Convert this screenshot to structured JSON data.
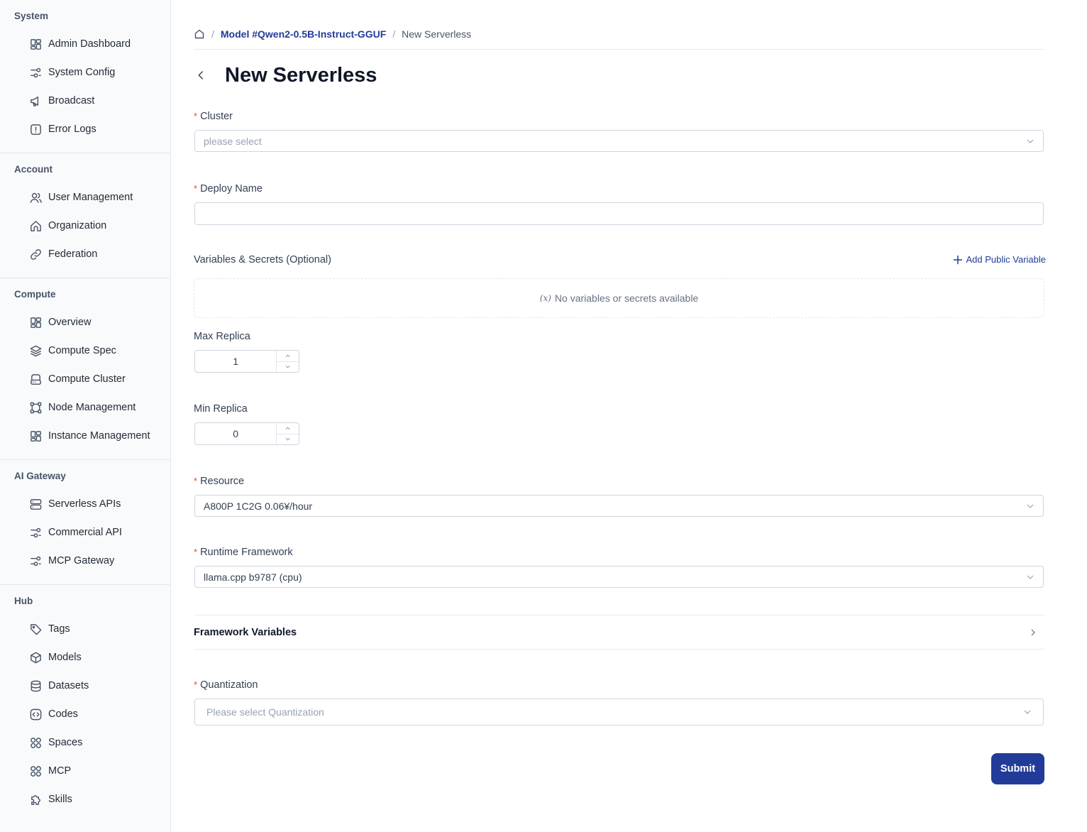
{
  "sidebar": {
    "sections": [
      {
        "title": "System",
        "items": [
          {
            "label": "Admin Dashboard",
            "icon": "dashboard-icon"
          },
          {
            "label": "System Config",
            "icon": "sliders-icon"
          },
          {
            "label": "Broadcast",
            "icon": "megaphone-icon"
          },
          {
            "label": "Error Logs",
            "icon": "alert-square-icon"
          }
        ]
      },
      {
        "title": "Account",
        "items": [
          {
            "label": "User Management",
            "icon": "users-icon"
          },
          {
            "label": "Organization",
            "icon": "organization-icon"
          },
          {
            "label": "Federation",
            "icon": "link-icon"
          }
        ]
      },
      {
        "title": "Compute",
        "items": [
          {
            "label": "Overview",
            "icon": "dashboard-icon"
          },
          {
            "label": "Compute Spec",
            "icon": "layers-icon"
          },
          {
            "label": "Compute Cluster",
            "icon": "hard-drive-icon"
          },
          {
            "label": "Node Management",
            "icon": "dataflow-icon"
          },
          {
            "label": "Instance Management",
            "icon": "dashboard-icon"
          }
        ]
      },
      {
        "title": "AI Gateway",
        "items": [
          {
            "label": "Serverless APIs",
            "icon": "server-icon"
          },
          {
            "label": "Commercial API",
            "icon": "sliders-icon"
          },
          {
            "label": "MCP Gateway",
            "icon": "sliders-icon"
          }
        ]
      },
      {
        "title": "Hub",
        "items": [
          {
            "label": "Tags",
            "icon": "tag-icon"
          },
          {
            "label": "Models",
            "icon": "cube-icon"
          },
          {
            "label": "Datasets",
            "icon": "database-icon"
          },
          {
            "label": "Codes",
            "icon": "code-square-icon"
          },
          {
            "label": "Spaces",
            "icon": "grid-circles-icon"
          },
          {
            "label": "MCP",
            "icon": "grid-circles-icon"
          },
          {
            "label": "Skills",
            "icon": "puzzle-icon"
          }
        ]
      }
    ]
  },
  "breadcrumb": {
    "home_icon": "home-icon",
    "separator": "/",
    "model_link": "Model #Qwen2-0.5B-Instruct-GGUF",
    "current": "New Serverless"
  },
  "page": {
    "title": "New Serverless",
    "back_icon": "chevron-left-icon"
  },
  "form": {
    "required_mark": "*",
    "cluster": {
      "label": "Cluster",
      "placeholder": "please select"
    },
    "deploy_name": {
      "label": "Deploy Name",
      "value": ""
    },
    "variables": {
      "label": "Variables & Secrets (Optional)",
      "add_label": "Add Public Variable",
      "empty_icon": "(𝑥)",
      "empty_text": "No variables or secrets available"
    },
    "max_replica": {
      "label": "Max Replica",
      "value": "1"
    },
    "min_replica": {
      "label": "Min Replica",
      "value": "0"
    },
    "resource": {
      "label": "Resource",
      "value": "A800P 1C2G 0.06¥/hour"
    },
    "runtime_framework": {
      "label": "Runtime Framework",
      "value": "llama.cpp b9787 (cpu)"
    },
    "framework_variables": {
      "label": "Framework Variables"
    },
    "quantization": {
      "label": "Quantization",
      "placeholder": "Please select Quantization"
    },
    "submit_label": "Submit"
  },
  "colors": {
    "brand": "#223b99",
    "required": "#f04438",
    "border": "#d0d5dd"
  }
}
